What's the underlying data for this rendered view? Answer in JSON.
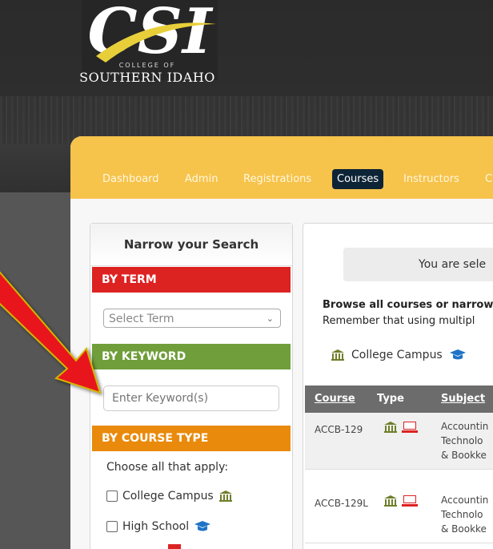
{
  "brand": {
    "college_of": "COLLEGE OF",
    "name": "SOUTHERN IDAHO",
    "accent": "#f6c34b",
    "swoosh": "#e8cf3a"
  },
  "nav": {
    "items": [
      "Dashboard",
      "Admin",
      "Registrations",
      "Courses",
      "Instructors",
      "C"
    ],
    "active": "Courses"
  },
  "sidebar": {
    "title": "Narrow your Search",
    "term": {
      "heading": "BY TERM",
      "color": "#dd2222",
      "select_value": "Select Term"
    },
    "keyword": {
      "heading": "BY KEYWORD",
      "color": "#6f9e3a",
      "placeholder": "Enter Keyword(s)"
    },
    "course_type": {
      "heading": "BY COURSE TYPE",
      "color": "#e98a0c",
      "choose_label": "Choose all that apply:",
      "options": [
        "College Campus",
        "High School"
      ]
    }
  },
  "main": {
    "notice": "You are sele",
    "browse_text": "Browse all courses or narrow",
    "remember_text": "Remember that using multipl",
    "legend_campus": "College Campus",
    "table": {
      "headers": [
        "Course",
        "Type",
        "Subject"
      ],
      "rows": [
        {
          "course": "ACCB-129",
          "subject": [
            "Accountin",
            "Technolo",
            "& Bookke"
          ]
        },
        {
          "course": "ACCB-129L",
          "subject": [
            "Accountin",
            "Technolo",
            "& Bookke"
          ]
        }
      ]
    }
  },
  "icons": {
    "campus": "building-columns-icon",
    "high_school": "graduation-cap-icon",
    "online": "laptop-icon",
    "annotation": "red-arrow"
  }
}
